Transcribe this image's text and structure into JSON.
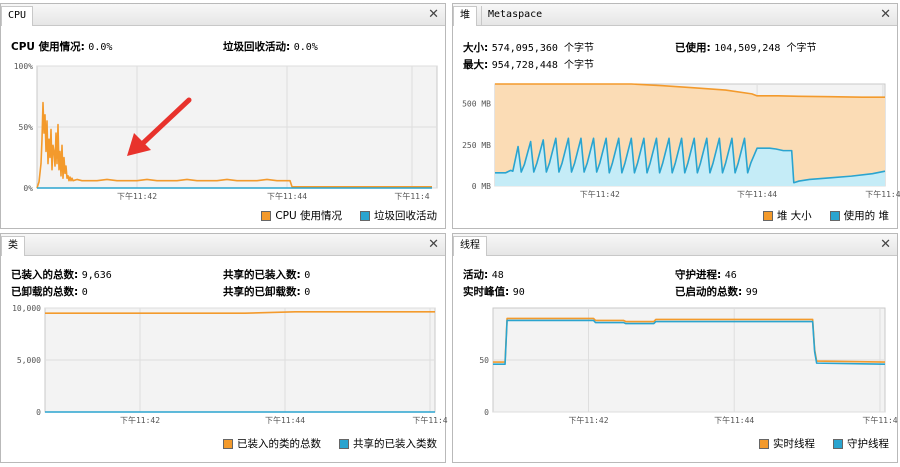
{
  "colors": {
    "orange": "#f39a2c",
    "orange_fill": "#fbdcb5",
    "blue": "#2aa4cf",
    "blue_fill": "#c5ecf7",
    "plot_bg": "#f3f3f3",
    "grid": "#dedede",
    "arrow": "#e8322c"
  },
  "cpu": {
    "tab": "CPU",
    "usage_label": "CPU 使用情况:",
    "usage_value": "0.0%",
    "gc_label": "垃圾回收活动:",
    "gc_value": "0.0%",
    "legend": [
      "CPU 使用情况",
      "垃圾回收活动"
    ],
    "y_ticks": [
      "100%",
      "50%",
      "0%"
    ],
    "x_ticks": [
      "下午11:42",
      "下午11:44",
      "下午11:4"
    ]
  },
  "heap": {
    "tabs": [
      "堆",
      "Metaspace"
    ],
    "size_label": "大小:",
    "size_value": "574,095,360 个字节",
    "used_label": "已使用:",
    "used_value": "104,509,248 个字节",
    "max_label": "最大:",
    "max_value": "954,728,448 个字节",
    "legend": [
      "堆 大小",
      "使用的 堆"
    ],
    "y_ticks": [
      "500 MB",
      "250 MB",
      "0 MB"
    ],
    "x_ticks": [
      "下午11:42",
      "下午11:44",
      "下午11:4"
    ]
  },
  "classes": {
    "tab": "类",
    "loaded_label": "已装入的总数:",
    "loaded_value": "9,636",
    "unloaded_label": "已卸载的总数:",
    "unloaded_value": "0",
    "shared_loaded_label": "共享的已装入数:",
    "shared_loaded_value": "0",
    "shared_unloaded_label": "共享的已卸载数:",
    "shared_unloaded_value": "0",
    "legend": [
      "已装入的类的总数",
      "共享的已装入类数"
    ],
    "y_ticks": [
      "10,000",
      "5,000",
      "0"
    ],
    "x_ticks": [
      "下午11:42",
      "下午11:44",
      "下午11:4"
    ]
  },
  "threads": {
    "tab": "线程",
    "live_label": "活动:",
    "live_value": "48",
    "peak_label": "实时峰值:",
    "peak_value": "90",
    "daemon_label": "守护进程:",
    "daemon_value": "46",
    "started_label": "已启动的总数:",
    "started_value": "99",
    "legend": [
      "实时线程",
      "守护线程"
    ],
    "y_ticks": [
      "50",
      "0"
    ],
    "x_ticks": [
      "下午11:42",
      "下午11:44",
      "下午11:4"
    ]
  },
  "chart_data": [
    {
      "type": "line",
      "title": "CPU",
      "ylim": [
        0,
        100
      ],
      "series": [
        {
          "name": "CPU 使用情况",
          "x": [
            0,
            2,
            4,
            5,
            6,
            7,
            8,
            9,
            10,
            11,
            12,
            13,
            14,
            15,
            16,
            17,
            18,
            19,
            20,
            21,
            22,
            23,
            24,
            25,
            26,
            27,
            28,
            29,
            30,
            31,
            32,
            33,
            34,
            35,
            36,
            40,
            45,
            50,
            60,
            70,
            80,
            90,
            100,
            110,
            120,
            130,
            140,
            150,
            160,
            170,
            180,
            190,
            200,
            210,
            220,
            230,
            240,
            250,
            253,
            255,
            265,
            280,
            300,
            320,
            340,
            360,
            380,
            395
          ],
          "y": [
            0,
            5,
            20,
            40,
            70,
            45,
            60,
            30,
            55,
            20,
            40,
            25,
            48,
            15,
            35,
            30,
            18,
            45,
            20,
            52,
            15,
            30,
            10,
            35,
            8,
            25,
            12,
            18,
            8,
            10,
            6,
            9,
            6,
            8,
            6,
            7,
            6,
            6,
            6,
            7,
            6,
            6,
            6,
            7,
            6,
            6,
            6,
            7,
            6,
            6,
            6,
            7,
            6,
            6,
            6,
            7,
            6,
            6,
            6,
            1,
            1,
            1,
            1,
            1,
            1,
            1,
            1,
            1
          ]
        },
        {
          "name": "垃圾回收活动",
          "x": [
            0,
            395
          ],
          "y": [
            0,
            0
          ]
        }
      ]
    },
    {
      "type": "area",
      "title": "堆",
      "ylim": [
        0,
        620
      ],
      "series": [
        {
          "name": "堆 大小",
          "x": [
            0,
            10,
            30,
            50,
            70,
            100,
            130,
            160,
            190,
            220,
            245,
            250,
            270,
            290,
            320,
            350,
            372
          ],
          "y": [
            662,
            662,
            664,
            655,
            648,
            640,
            625,
            610,
            597,
            583,
            560,
            548,
            548,
            545,
            543,
            540,
            540
          ]
        },
        {
          "name": "使用的 堆",
          "x": [
            0,
            5,
            10,
            15,
            17,
            22,
            25,
            28,
            34,
            37,
            40,
            46,
            49,
            52,
            58,
            61,
            64,
            70,
            73,
            76,
            82,
            85,
            88,
            94,
            97,
            100,
            106,
            109,
            112,
            118,
            121,
            124,
            130,
            133,
            136,
            142,
            145,
            148,
            154,
            157,
            160,
            166,
            169,
            172,
            178,
            181,
            184,
            190,
            193,
            196,
            202,
            205,
            208,
            214,
            217,
            220,
            226,
            229,
            232,
            238,
            241,
            244,
            250,
            255,
            262,
            268,
            275,
            280,
            283,
            285,
            290,
            300,
            320,
            340,
            360,
            372
          ],
          "y": [
            80,
            80,
            80,
            95,
            90,
            240,
            85,
            130,
            270,
            85,
            140,
            280,
            85,
            140,
            290,
            85,
            140,
            290,
            85,
            140,
            290,
            85,
            140,
            290,
            85,
            140,
            290,
            80,
            140,
            290,
            80,
            140,
            290,
            80,
            140,
            290,
            80,
            140,
            290,
            80,
            140,
            290,
            80,
            140,
            290,
            80,
            140,
            290,
            80,
            140,
            290,
            80,
            140,
            290,
            80,
            140,
            290,
            80,
            140,
            290,
            80,
            140,
            230,
            230,
            230,
            225,
            215,
            215,
            215,
            20,
            30,
            40,
            50,
            60,
            75,
            90
          ]
        }
      ]
    },
    {
      "type": "line",
      "title": "类",
      "ylim": [
        0,
        10000
      ],
      "series": [
        {
          "name": "已装入的类的总数",
          "x": [
            0,
            200,
            250,
            390
          ],
          "y": [
            9500,
            9500,
            9636,
            9636
          ]
        },
        {
          "name": "共享的已装入类数",
          "x": [
            0,
            390
          ],
          "y": [
            0,
            0
          ]
        }
      ]
    },
    {
      "type": "line",
      "title": "线程",
      "ylim": [
        0,
        100
      ],
      "series": [
        {
          "name": "实时线程",
          "x": [
            0,
            12,
            14,
            100,
            102,
            130,
            132,
            160,
            162,
            220,
            222,
            318,
            320,
            322,
            390
          ],
          "y": [
            48,
            48,
            90,
            90,
            88,
            88,
            87,
            87,
            89,
            89,
            89,
            89,
            60,
            49,
            48
          ]
        },
        {
          "name": "守护线程",
          "x": [
            0,
            12,
            14,
            100,
            102,
            130,
            132,
            160,
            162,
            220,
            222,
            318,
            320,
            322,
            390
          ],
          "y": [
            46,
            46,
            88,
            88,
            86,
            86,
            85,
            85,
            87,
            87,
            87,
            87,
            58,
            47,
            46
          ]
        }
      ]
    }
  ]
}
